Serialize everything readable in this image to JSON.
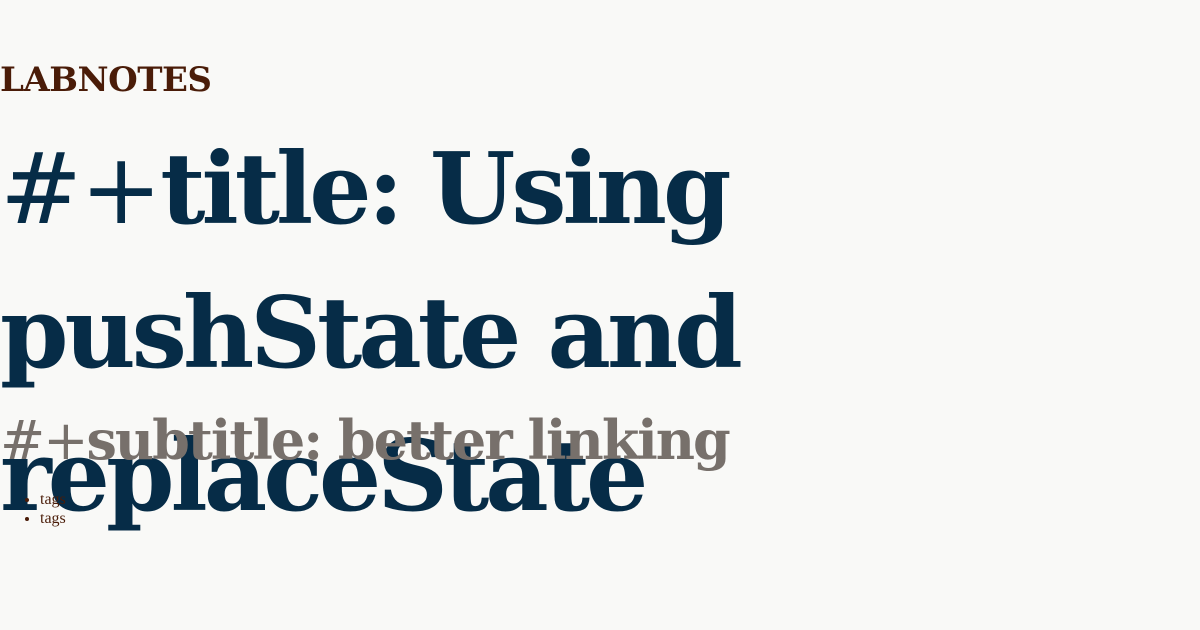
{
  "brand": {
    "name": "LABNOTES"
  },
  "post": {
    "title_prefix": "#+",
    "title_text": "title: Using pushState and replaceState",
    "subtitle_prefix": "#+",
    "subtitle_text": "subtitle: better linking"
  },
  "tags": [
    {
      "label": "tags"
    },
    {
      "label": "tags"
    }
  ],
  "colors": {
    "background": "#f9f9f7",
    "brand": "#4a1c08",
    "title": "#062c47",
    "subtitle": "#77706b"
  }
}
